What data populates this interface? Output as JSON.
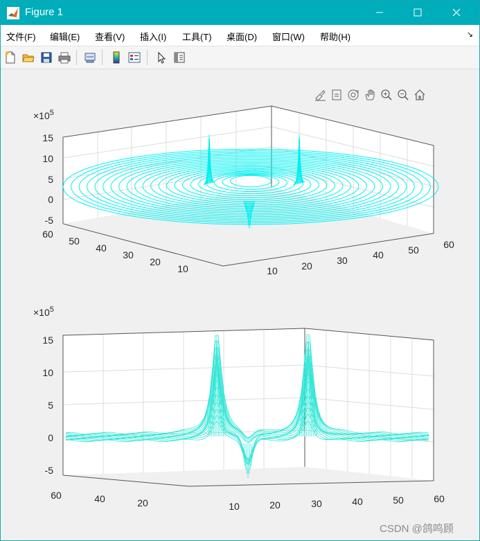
{
  "window": {
    "title": "Figure 1",
    "controls": {
      "minimize": "—",
      "maximize": "☐",
      "close": "✕"
    }
  },
  "menubar": {
    "items": [
      {
        "label": "文件(F)"
      },
      {
        "label": "编辑(E)"
      },
      {
        "label": "查看(V)"
      },
      {
        "label": "插入(I)"
      },
      {
        "label": "工具(T)"
      },
      {
        "label": "桌面(D)"
      },
      {
        "label": "窗口(W)"
      },
      {
        "label": "帮助(H)"
      }
    ],
    "overflow_arrow": "↘"
  },
  "toolbar": {
    "buttons": [
      "new-figure-icon",
      "open-file-icon",
      "save-icon",
      "print-icon",
      "link-plot-icon",
      "colorbar-icon",
      "legend-icon",
      "pointer-icon",
      "property-inspector-icon"
    ]
  },
  "axes_toolbar": {
    "buttons": [
      "brush-icon",
      "data-tips-icon",
      "rotate-3d-icon",
      "pan-icon",
      "zoom-in-icon",
      "zoom-out-icon",
      "home-icon"
    ]
  },
  "colors": {
    "title_bar": "#00adbb",
    "surface_line": "#00ffff",
    "surface_line_alt": "#40e0d0"
  },
  "chart_data": [
    {
      "type": "surface3d-mesh",
      "exponent_label": "×10",
      "exponent_power": "5",
      "z_ticks": [
        "15",
        "10",
        "5",
        "0",
        "-5"
      ],
      "left_axis_ticks": [
        "60",
        "50",
        "40",
        "30",
        "20",
        "10"
      ],
      "right_axis_ticks": [
        "10",
        "20",
        "30",
        "40",
        "50",
        "60"
      ],
      "z_range": [
        -5,
        15
      ],
      "xy_range": [
        0,
        60
      ],
      "grid": true
    },
    {
      "type": "surface3d-mesh",
      "exponent_label": "×10",
      "exponent_power": "5",
      "z_ticks": [
        "15",
        "10",
        "5",
        "0",
        "-5"
      ],
      "left_axis_ticks": [
        "60",
        "40",
        "20"
      ],
      "right_axis_ticks": [
        "10",
        "20",
        "30",
        "40",
        "50",
        "60"
      ],
      "z_range": [
        -5,
        15
      ],
      "xy_range": [
        0,
        60
      ],
      "grid": true
    }
  ],
  "watermark": "CSDN @鸽鸣顾"
}
